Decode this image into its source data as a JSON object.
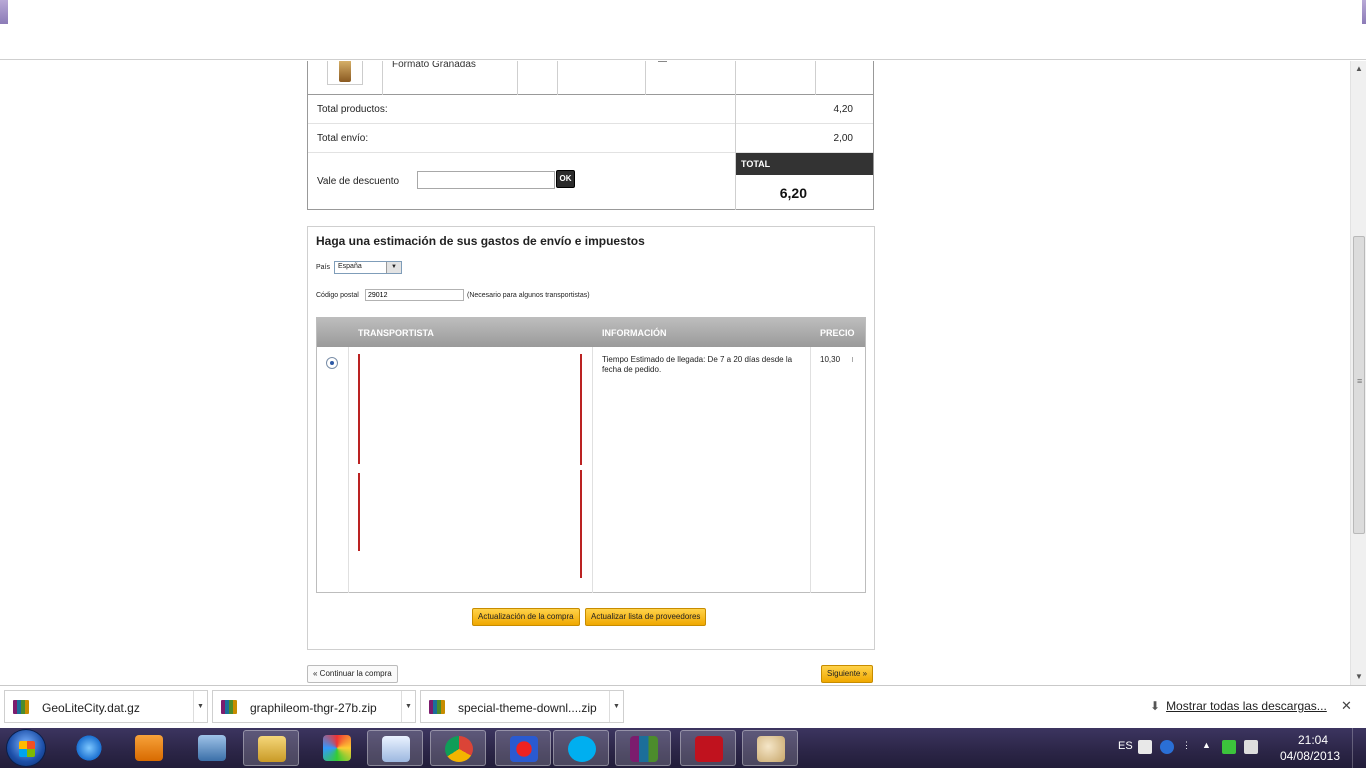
{
  "cart": {
    "product_name": "Formato Granadas",
    "total_products_label": "Total productos:",
    "total_products_value": "4,20",
    "total_shipping_label": "Total envío:",
    "total_shipping_value": "2,00",
    "discount_label": "Vale de descuento",
    "discount_value": "",
    "ok_label": "OK",
    "total_label": "TOTAL",
    "total_value": "6,20"
  },
  "estimate": {
    "title": "Haga una estimación de sus gastos de envío e impuestos",
    "country_label": "País",
    "country_value": "España",
    "zip_label": "Código postal",
    "zip_value": "29012",
    "zip_note": "(Necesario para algunos transportistas)",
    "columns": [
      "TRANSPORTISTA",
      "INFORMACIÓN",
      "PRECIO"
    ],
    "carrier_info": "Tiempo Estimado de llegada: De 7 a 20 días desde la fecha de pedido.",
    "carrier_price": "10,30",
    "update_purchase_label": "Actualización de la compra",
    "update_providers_label": "Actualizar lista de proveedores"
  },
  "nav": {
    "continue_label": "« Continuar la compra",
    "next_label": "Siguiente »"
  },
  "downloads": {
    "items": [
      "GeoLiteCity.dat.gz",
      "graphileom-thgr-27b.zip",
      "special-theme-downl....zip"
    ],
    "show_all_label": "Mostrar todas las descargas...",
    "close_icon": "close-icon"
  },
  "taskbar": {
    "apps": [
      "internet-explorer-icon",
      "media-player-icon",
      "image-viewer-icon",
      "file-explorer-icon",
      "media-app-icon",
      "spreadsheet-icon",
      "chrome-icon",
      "paint-app-icon",
      "skype-icon",
      "winrar-icon",
      "filezilla-icon",
      "paint-icon"
    ],
    "language": "ES",
    "time": "21:04",
    "date": "04/08/2013"
  }
}
